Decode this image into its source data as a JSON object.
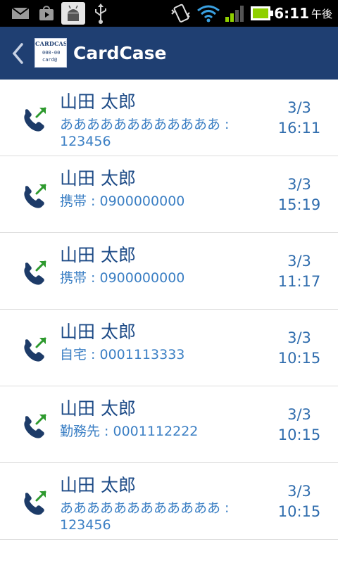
{
  "status_bar": {
    "time": "6:11",
    "ampm": "午後"
  },
  "action_bar": {
    "title": "CardCase",
    "logo": {
      "brand": "CARDCASE",
      "phone": "000-00",
      "email": "card@"
    }
  },
  "calls": [
    {
      "name": "山田 太郎",
      "detail": "ああああああああああああ : 123456",
      "date": "3/3",
      "time": "16:11"
    },
    {
      "name": "山田 太郎",
      "detail": "携帯 : 0900000000",
      "date": "3/3",
      "time": "15:19"
    },
    {
      "name": "山田 太郎",
      "detail": "携帯 : 0900000000",
      "date": "3/3",
      "time": "11:17"
    },
    {
      "name": "山田 太郎",
      "detail": "自宅 : 0001113333",
      "date": "3/3",
      "time": "10:15"
    },
    {
      "name": "山田 太郎",
      "detail": "勤務先 : 0001112222",
      "date": "3/3",
      "time": "10:15"
    },
    {
      "name": "山田 太郎",
      "detail": "ああああああああああああ : 123456",
      "date": "3/3",
      "time": "10:15"
    }
  ],
  "icons": {
    "call": "outgoing-call-icon",
    "back": "chevron-left-icon"
  },
  "colors": {
    "action_bar": "#1f3f72",
    "name": "#1c4a86",
    "detail": "#3b7fc4",
    "arrow": "#2e9a2e"
  }
}
